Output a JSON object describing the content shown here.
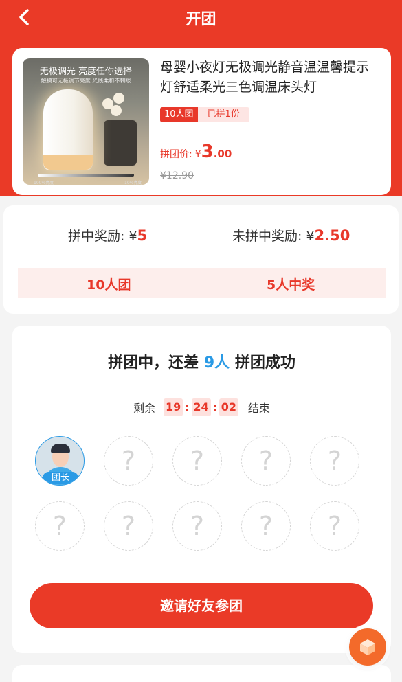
{
  "header": {
    "title": "开团",
    "back_icon": "chevron-left-icon"
  },
  "product": {
    "image_text_line1": "无极调光 亮度任你选择",
    "image_text_line2": "触摸可无极调节亮度 光线柔和不刺眼",
    "image_caption_left": "100%亮度",
    "image_caption_right": "10%亮度",
    "name": "母婴小夜灯无极调光静音温温馨提示灯舒适柔光三色调温床头灯",
    "tag_group": "10人团",
    "tag_joined": "已拼1份",
    "price_label": "拼团价:",
    "currency": "¥",
    "price_int": "3",
    "price_dec": ".00",
    "original_price": "¥12.90"
  },
  "reward": {
    "win_label": "拼中奖励: ¥",
    "win_value": "5",
    "lose_label": "未拼中奖励: ¥",
    "lose_value": "2.50",
    "group_size": "10人团",
    "winners": "5人中奖"
  },
  "group": {
    "status_prefix": "拼团中，还差 ",
    "status_count": "9人",
    "status_suffix": " 拼团成功",
    "remain_label": "剩余",
    "hours": "19",
    "minutes": "24",
    "seconds": "02",
    "end_label": "结束",
    "leader_tag": "团长",
    "slot_placeholder": "?",
    "invite_button": "邀请好友参团"
  },
  "colors": {
    "primary": "#ea3a27",
    "accent_blue": "#2a9ae5",
    "fab": "#f36a2a"
  }
}
